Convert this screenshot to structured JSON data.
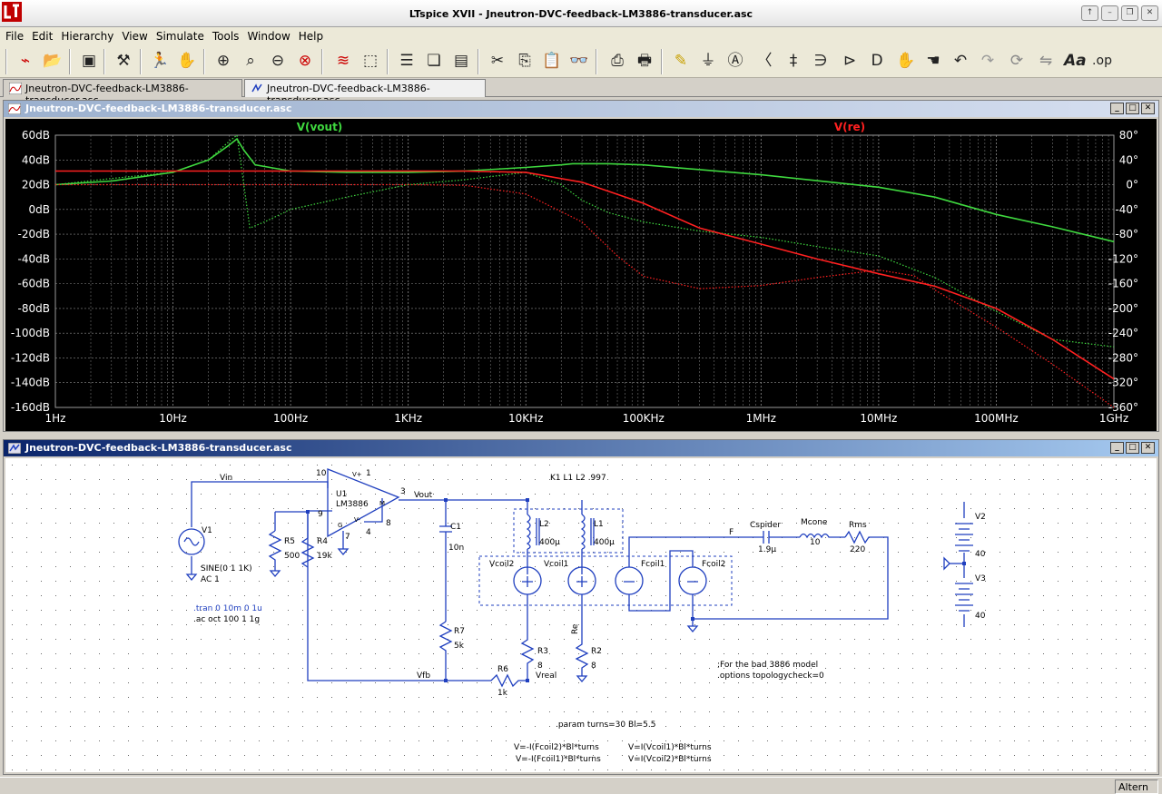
{
  "window": {
    "title": "LTspice XVII - Jneutron-DVC-feedback-LM3886-transducer.asc"
  },
  "menu": [
    "File",
    "Edit",
    "Hierarchy",
    "View",
    "Simulate",
    "Tools",
    "Window",
    "Help"
  ],
  "toolbar_icons": [
    "new-schematic-icon",
    "open-folder-icon",
    "save-icon",
    "control-panel-icon",
    "run-icon",
    "halt-icon",
    "zoom-in-icon",
    "zoom-pan-icon",
    "zoom-out-icon",
    "zoom-cancel-icon",
    "autoscale-icon",
    "pick-traces-icon",
    "tile-horizontal-icon",
    "cascade-icon",
    "tile-vertical-icon",
    "cut-icon",
    "copy-icon",
    "paste-icon",
    "find-icon",
    "print-preview-icon",
    "print-icon",
    "draw-wire-icon",
    "ground-icon",
    "label-net-icon",
    "resistor-icon",
    "capacitor-icon",
    "inductor-icon",
    "diode-icon",
    "component-icon",
    "move-icon",
    "drag-icon",
    "undo-icon",
    "redo-icon",
    "rotate-icon",
    "mirror-icon",
    "text-icon",
    "spice-directive-icon"
  ],
  "tabs": [
    {
      "label": "Jneutron-DVC-feedback-LM3886-transducer.asc",
      "icon": "waveform-icon"
    },
    {
      "label": "Jneutron-DVC-feedback-LM3886-transducer.asc",
      "icon": "schematic-icon"
    }
  ],
  "plot_window": {
    "title": "Jneutron-DVC-feedback-LM3886-transducer.asc"
  },
  "schematic_window": {
    "title": "Jneutron-DVC-feedback-LM3886-transducer.asc"
  },
  "status": {
    "text": "Altern"
  },
  "colors": {
    "vout": "#3fd83f",
    "vre": "#ff2020",
    "grid": "#8a8a8a",
    "wire": "#1f3fbf",
    "plot_bg": "#000000",
    "title_active": "#0a246a"
  },
  "chart_data": {
    "type": "line",
    "title": "",
    "x_scale": "log",
    "xlim": [
      1,
      1000000000
    ],
    "x_ticks": [
      "1Hz",
      "10Hz",
      "100Hz",
      "1KHz",
      "10KHz",
      "100KHz",
      "1MHz",
      "10MHz",
      "100MHz",
      "1GHz"
    ],
    "ylim_left": [
      -160,
      60
    ],
    "y_ticks_left": [
      "60dB",
      "40dB",
      "20dB",
      "0dB",
      "-20dB",
      "-40dB",
      "-60dB",
      "-80dB",
      "-100dB",
      "-120dB",
      "-140dB",
      "-160dB"
    ],
    "ylim_right": [
      -360,
      80
    ],
    "y_ticks_right": [
      "80°",
      "40°",
      "0°",
      "-40°",
      "-80°",
      "-120°",
      "-160°",
      "-200°",
      "-240°",
      "-280°",
      "-320°",
      "-360°"
    ],
    "grid": true,
    "series": [
      {
        "name": "V(vout)",
        "quantity": "magnitude_dB",
        "color": "#3fd83f",
        "x": [
          1,
          3,
          10,
          20,
          30,
          35,
          40,
          50,
          100,
          300,
          1000,
          3000,
          10000,
          20000,
          25000,
          50000,
          100000,
          1000000,
          10000000,
          30000000,
          100000000,
          300000000,
          1000000000
        ],
        "y": [
          20,
          23,
          30,
          40,
          52,
          57,
          48,
          36,
          31,
          30,
          30,
          31,
          34,
          36,
          37,
          37,
          36,
          28,
          18,
          10,
          -4,
          -14,
          -26
        ]
      },
      {
        "name": "V(vout)",
        "quantity": "phase_deg",
        "color": "#3fd83f",
        "x": [
          1,
          3,
          10,
          20,
          30,
          35,
          40,
          45,
          60,
          100,
          300,
          1000,
          3000,
          10000,
          20000,
          30000,
          50000,
          100000,
          300000,
          1000000,
          3000000,
          10000000,
          30000000,
          100000000,
          300000000,
          1000000000
        ],
        "y": [
          0,
          10,
          20,
          40,
          70,
          80,
          0,
          -70,
          -60,
          -40,
          -20,
          0,
          8,
          20,
          0,
          -25,
          -45,
          -60,
          -75,
          -85,
          -100,
          -115,
          -150,
          -205,
          -250,
          -262
        ]
      },
      {
        "name": "V(re)",
        "quantity": "magnitude_dB",
        "color": "#ff2020",
        "x": [
          1,
          10,
          100,
          1000,
          3000,
          10000,
          30000,
          100000,
          300000,
          1000000,
          3000000,
          10000000,
          30000000,
          100000000,
          300000000,
          1000000000
        ],
        "y": [
          31,
          31,
          31,
          31,
          31,
          30,
          22,
          5,
          -15,
          -28,
          -40,
          -52,
          -62,
          -80,
          -105,
          -137
        ]
      },
      {
        "name": "V(re)",
        "quantity": "phase_deg",
        "color": "#ff2020",
        "x": [
          1,
          100,
          1000,
          3000,
          10000,
          30000,
          60000,
          100000,
          300000,
          1000000,
          3000000,
          10000000,
          20000000,
          30000000,
          100000000,
          300000000,
          1000000000
        ],
        "y": [
          0,
          0,
          0,
          -1,
          -15,
          -60,
          -115,
          -148,
          -168,
          -163,
          -150,
          -138,
          -147,
          -170,
          -230,
          -290,
          -360
        ]
      }
    ]
  },
  "schematic": {
    "labels": {
      "vin": "Vin",
      "vout": "Vout",
      "vfb": "Vfb",
      "vreal": "Vreal",
      "re": "Re",
      "f": "F",
      "coupling": "K1 L1 L2 .997",
      "u1": "U1",
      "u1_value": "LM3886",
      "pin10": "10",
      "pin1": "1",
      "pin3": "3",
      "pin9": "9",
      "pin7": "7",
      "pin4": "4",
      "pin8": "8",
      "pin_vplus": "V+",
      "pin_vminus": "V-",
      "pin_g": "G",
      "pin_m": "M",
      "v1": "V1",
      "v1_value": "SINE(0 1 1K)",
      "v1_ac": "AC 1",
      "r5": "R5",
      "r5_value": "500",
      "r4": "R4",
      "r4_value": "19k",
      "c1": "C1",
      "c1_value": "10n",
      "l2": "L2",
      "l2_value": "400µ",
      "l1": "L1",
      "l1_value": "400µ",
      "vcoil2": "Vcoil2",
      "vcoil1": "Vcoil1",
      "fcoil1": "Fcoil1",
      "fcoil2": "Fcoil2",
      "cspider": "Cspider",
      "cspider_value": "1.9µ",
      "mcone": "Mcone",
      "mcone_value": "10",
      "rms": "Rms",
      "rms_value": "220",
      "v2": "V2",
      "v2_value": "40",
      "v3": "V3",
      "v3_value": "40",
      "r7": "R7",
      "r7_value": "5k",
      "r3": "R3",
      "r3_value": "8",
      "r2": "R2",
      "r2_value": "8",
      "r6": "R6",
      "r6_value": "1k",
      "dir_tran": ".tran 0 10m 0 1u",
      "dir_ac": ".ac oct 100 1 1g",
      "comment1": ";For the bad 3886 model",
      "dir_options": ".options topologycheck=0",
      "dir_param": ".param turns=30 Bl=5.5",
      "fcoil2_expr": "V=-I(Fcoil2)*Bl*turns",
      "fcoil1_expr": "V=-I(Fcoil1)*Bl*turns",
      "vcoil1_expr": "V=I(Vcoil1)*Bl*turns",
      "vcoil2_expr": "V=I(Vcoil2)*Bl*turns"
    }
  }
}
